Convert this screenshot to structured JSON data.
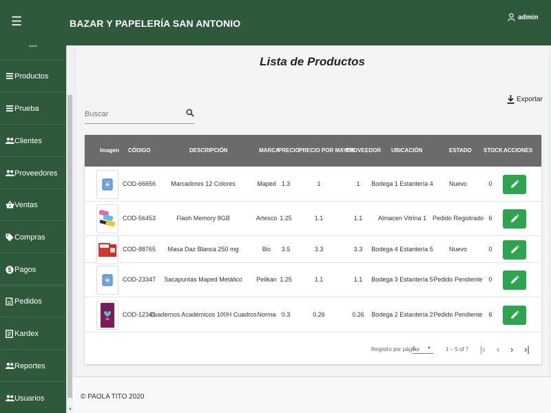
{
  "header": {
    "brand": "BAZAR Y PAPELERÍA SAN ANTONIO",
    "user": "admin"
  },
  "sidebar": {
    "items": [
      {
        "label": "Productos",
        "icon": "list-icon"
      },
      {
        "label": "Prueba",
        "icon": "list-icon"
      },
      {
        "label": "Clientes",
        "icon": "group-icon"
      },
      {
        "label": "Proveedores",
        "icon": "group-icon"
      },
      {
        "label": "Ventas",
        "icon": "basket-icon"
      },
      {
        "label": "Compras",
        "icon": "tag-icon"
      },
      {
        "label": "Pagos",
        "icon": "dollar-icon"
      },
      {
        "label": "Pedidos",
        "icon": "note-add-icon"
      },
      {
        "label": "Kardex",
        "icon": "document-icon"
      },
      {
        "label": "Reportes",
        "icon": "group-icon"
      },
      {
        "label": "Usuarios",
        "icon": "group-icon"
      }
    ]
  },
  "main": {
    "title": "Lista de Productos",
    "export_label": "Exportar",
    "search_placeholder": "Buscar"
  },
  "table": {
    "columns": [
      "Imagen",
      "CÓDIGO",
      "DESCRIPCIÓN",
      "MARCA",
      "PRECIO",
      "PRECIO POR MAYOR",
      "PROVEEDOR",
      "UBICACIÓN",
      "ESTADO",
      "STOCK",
      "ACCIONES"
    ],
    "rows": [
      {
        "codigo": "COD-66656",
        "descripcion": "Marcadores 12 Colores",
        "marca": "Maped",
        "precio": "1.3",
        "precio_mayor": "1",
        "proveedor": "1",
        "ubicacion": "Bodega 1 Estantería 4",
        "estado": "Nuevo",
        "stock": "0",
        "image": "placeholder-icon"
      },
      {
        "codigo": "COD-56453",
        "descripcion": "Flash Memory 8GB",
        "marca": "Artesco",
        "precio": "1.25",
        "precio_mayor": "1.1",
        "proveedor": "1.1",
        "ubicacion": "Almacen Vitrina 1",
        "estado": "Pedido Registrado",
        "stock": "6",
        "image": "flash-memory-photo"
      },
      {
        "codigo": "COD-88765",
        "descripcion": "Masa Daz Blanca 250 mg",
        "marca": "Bic",
        "precio": "3.5",
        "precio_mayor": "3.3",
        "proveedor": "3.3",
        "ubicacion": "Bodega 4 Estantería 5",
        "estado": "Nuevo",
        "stock": "0",
        "image": "masa-box-photo"
      },
      {
        "codigo": "COD-23347",
        "descripcion": "Sacapuntas Maped Metálico",
        "marca": "Pelikan",
        "precio": "1.25",
        "precio_mayor": "1.1",
        "proveedor": "1.1",
        "ubicacion": "Bodega 3 Estantería 5",
        "estado": "Pedido Pendiente",
        "stock": "0",
        "image": "placeholder-icon"
      },
      {
        "codigo": "COD-12349",
        "descripcion": "Cuadernos Académicos 100H Cuadros",
        "marca": "Norma",
        "precio": "0.3",
        "precio_mayor": "0.26",
        "proveedor": "0.26",
        "ubicacion": "Bodega 2 Estantería 2",
        "estado": "Pedido Pendiente",
        "stock": "6",
        "image": "notebook-photo"
      }
    ]
  },
  "pagination": {
    "rows_per_page_label": "Registro por página",
    "rows_per_page": "5",
    "range": "1 – 5 of 7"
  },
  "footer": {
    "text": "© PAOLA TITO 2020"
  },
  "colors": {
    "header_green": "#2e5a3b",
    "edit_button": "#2da44e",
    "table_header": "#6b6b6b"
  }
}
